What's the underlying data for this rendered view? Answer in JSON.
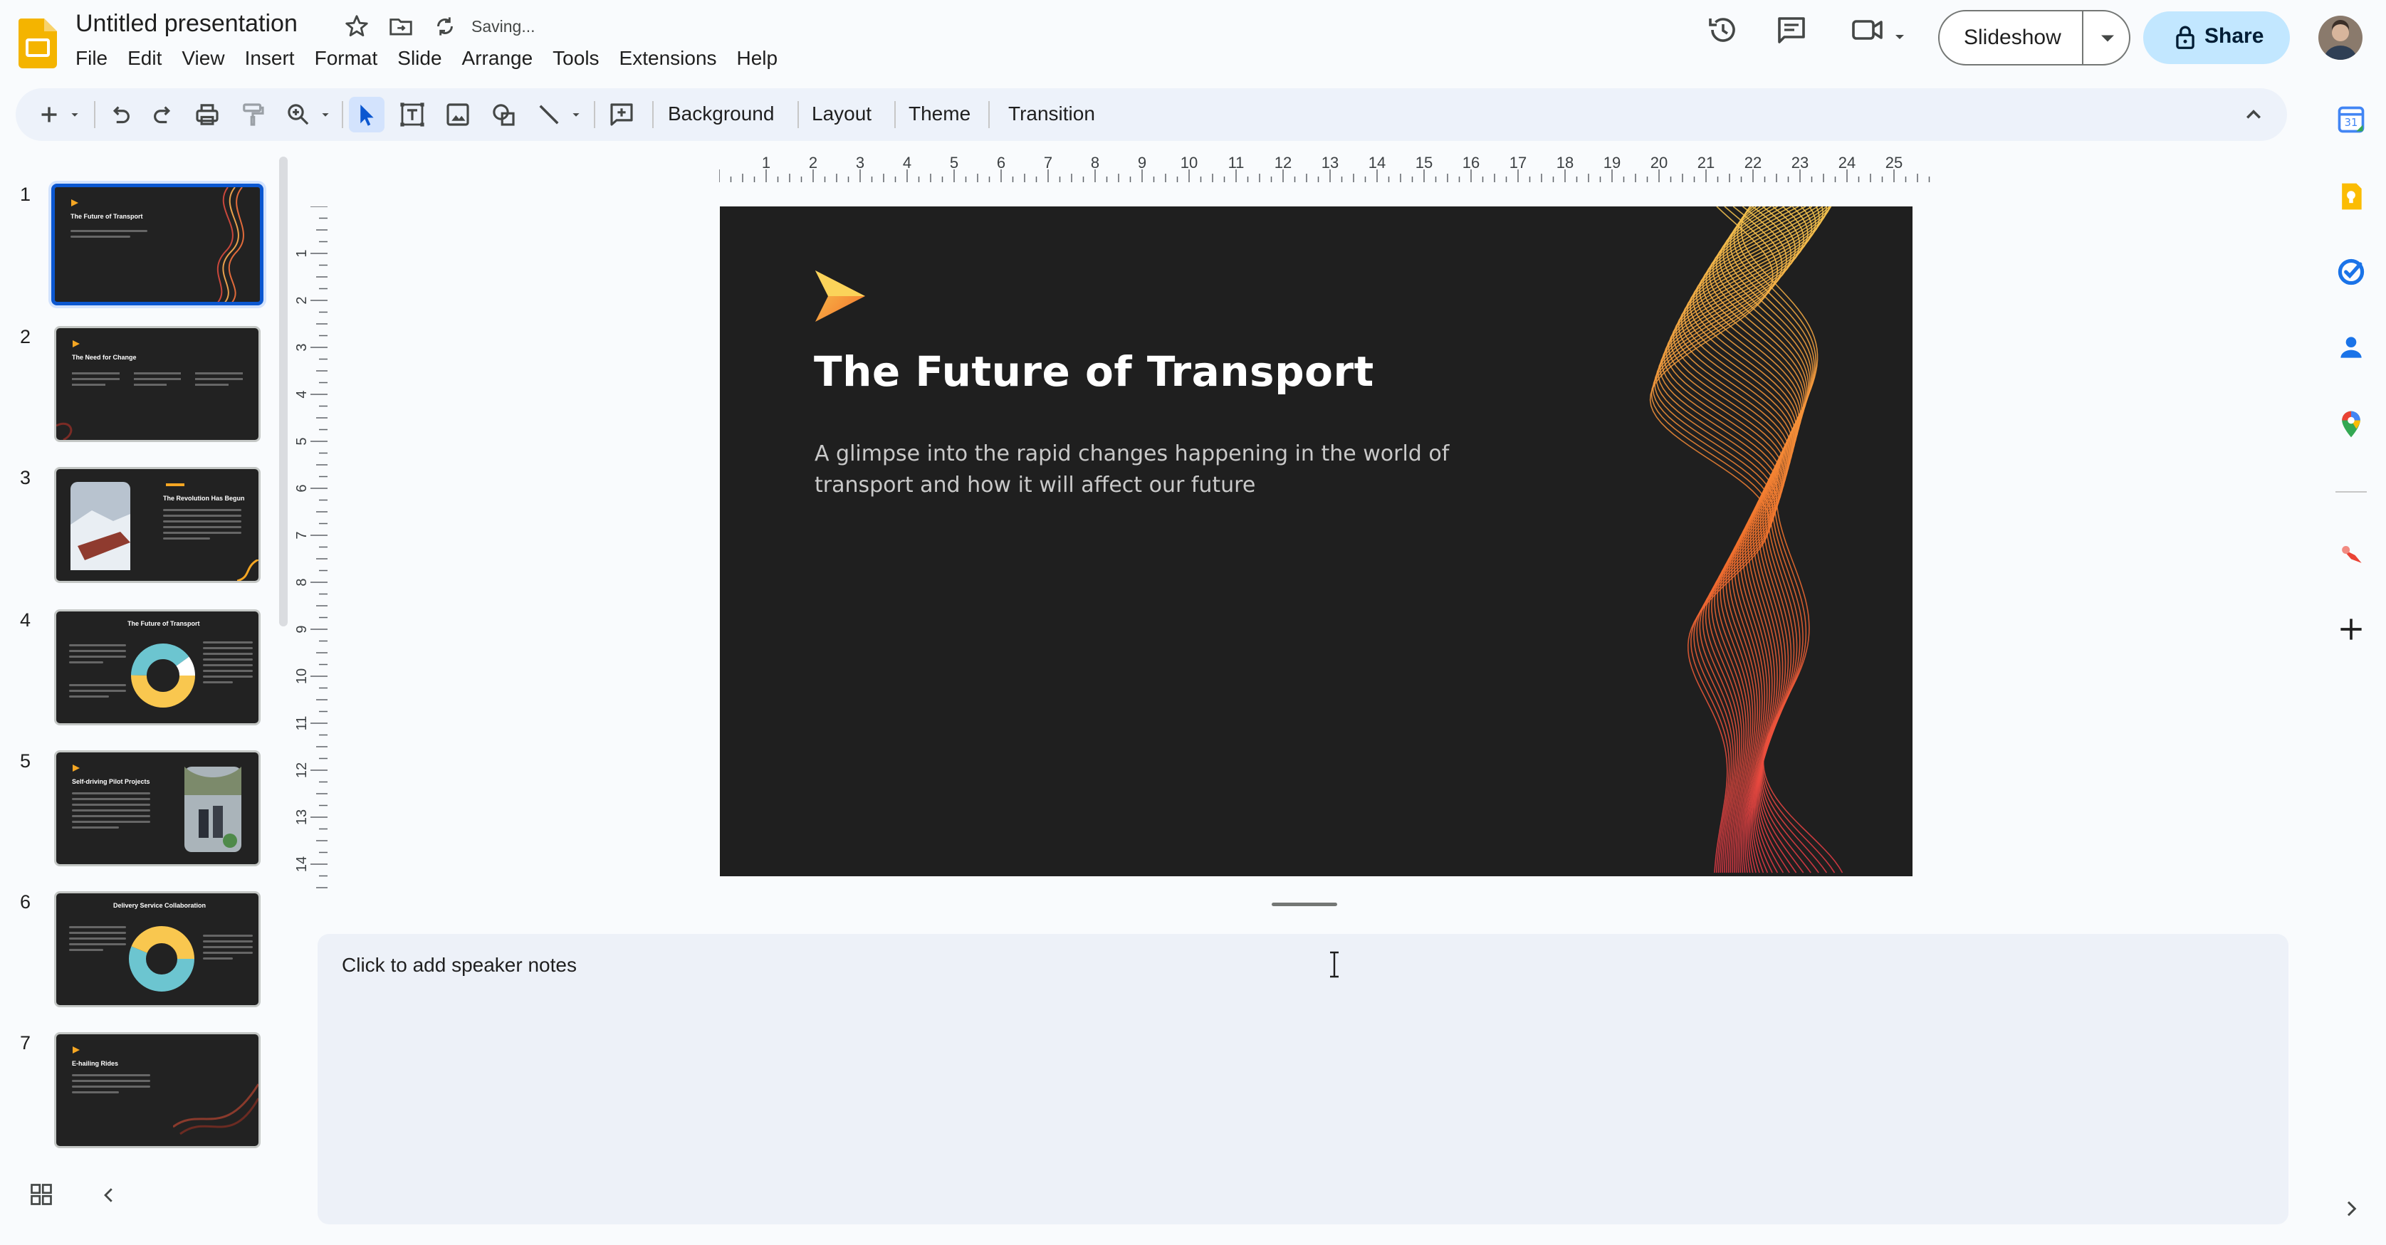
{
  "app": {
    "doc_title": "Untitled presentation",
    "save_status": "Saving...",
    "menu": [
      "File",
      "Edit",
      "View",
      "Insert",
      "Format",
      "Slide",
      "Arrange",
      "Tools",
      "Extensions",
      "Help"
    ],
    "slideshow_label": "Slideshow",
    "share_label": "Share",
    "accent_color": "#0b57d0",
    "share_bg": "#c2e7ff"
  },
  "toolbar": {
    "background_label": "Background",
    "layout_label": "Layout",
    "theme_label": "Theme",
    "transition_label": "Transition"
  },
  "ruler": {
    "horizontal_ticks": [
      "1",
      "2",
      "3",
      "4",
      "5",
      "6",
      "7",
      "8",
      "9",
      "10",
      "11",
      "12",
      "13",
      "14",
      "15",
      "16",
      "17",
      "18",
      "19",
      "20",
      "21",
      "22",
      "23",
      "24",
      "25"
    ],
    "vertical_ticks": [
      "1",
      "2",
      "3",
      "4",
      "5",
      "6",
      "7",
      "8",
      "9",
      "10",
      "11",
      "12",
      "13",
      "14"
    ]
  },
  "filmstrip": {
    "slides": [
      {
        "num": "1",
        "title": "The Future of Transport"
      },
      {
        "num": "2",
        "title": "The Need for Change"
      },
      {
        "num": "3",
        "title": "The Revolution Has Begun"
      },
      {
        "num": "4",
        "title": "The Future of Transport"
      },
      {
        "num": "5",
        "title": "Self-driving Pilot Projects"
      },
      {
        "num": "6",
        "title": "Delivery Service Collaboration"
      },
      {
        "num": "7",
        "title": "E-hailing Rides"
      }
    ]
  },
  "slide": {
    "title": "The Future of Transport",
    "subtitle": "A glimpse into the rapid changes happening in the world of transport and how it will affect our future",
    "bg_color": "#1f1f1f",
    "accent_gradient": [
      "#f9c74f",
      "#f3722c",
      "#e63946"
    ]
  },
  "notes": {
    "placeholder": "Click to add speaker notes"
  },
  "side_panel": {
    "icons": [
      "calendar-icon",
      "keep-icon",
      "tasks-icon",
      "contacts-icon",
      "maps-icon",
      "addon-icon",
      "add-icon"
    ]
  }
}
